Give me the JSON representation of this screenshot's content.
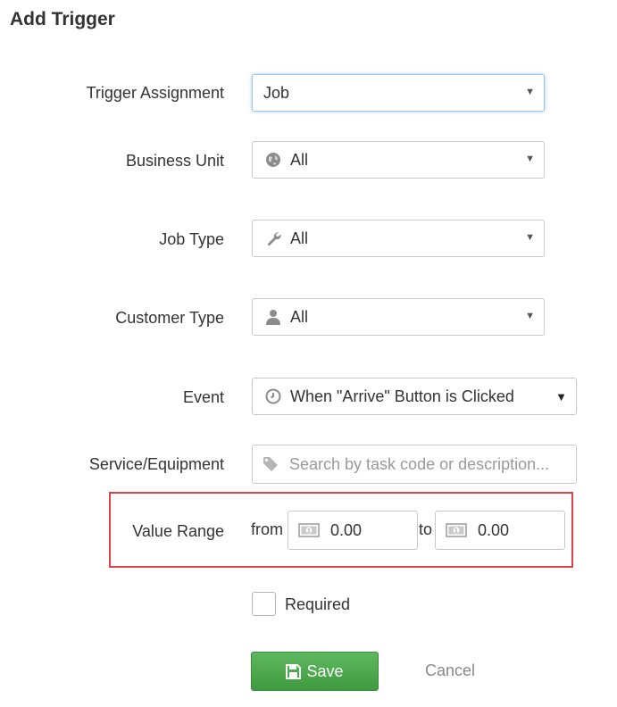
{
  "title": "Add Trigger",
  "fields": {
    "trigger_assignment": {
      "label": "Trigger Assignment",
      "value": "Job"
    },
    "business_unit": {
      "label": "Business Unit",
      "value": "All",
      "icon": "globe-icon"
    },
    "job_type": {
      "label": "Job Type",
      "value": "All",
      "icon": "wrench-icon"
    },
    "customer_type": {
      "label": "Customer Type",
      "value": "All",
      "icon": "user-icon"
    },
    "event": {
      "label": "Event",
      "value": "When \"Arrive\" Button is Clicked",
      "icon": "clock-icon"
    },
    "service_equipment": {
      "label": "Service/Equipment",
      "placeholder": "Search by task code or description...",
      "icon": "tag-icon"
    },
    "value_range": {
      "label": "Value Range",
      "from_label": "from",
      "from_value": "0.00",
      "to_label": "to",
      "to_value": "0.00",
      "icon": "money-icon"
    }
  },
  "required": {
    "label": "Required",
    "checked": false
  },
  "actions": {
    "save_label": "Save",
    "cancel_label": "Cancel"
  },
  "colors": {
    "save_button": "#4cae4c",
    "highlight": "#e0424a",
    "focus_border": "#9ec3e6"
  }
}
